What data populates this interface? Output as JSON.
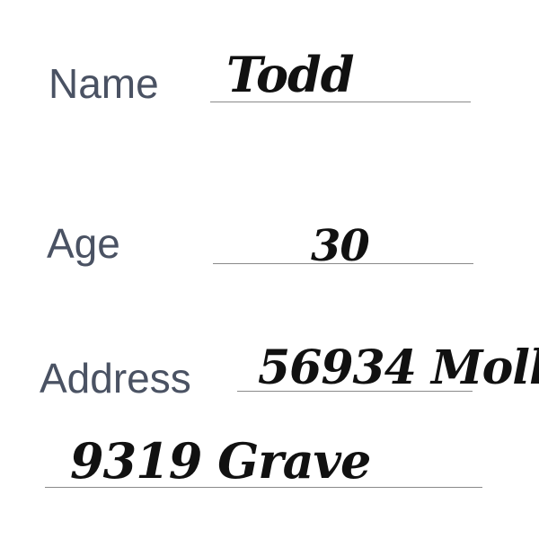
{
  "form": {
    "fields": [
      {
        "label": "Name",
        "value": "Todd"
      },
      {
        "label": "Age",
        "value": "30"
      },
      {
        "label": "Address",
        "value": "56934 Moll",
        "value_line2": "9319 Grave"
      }
    ]
  }
}
